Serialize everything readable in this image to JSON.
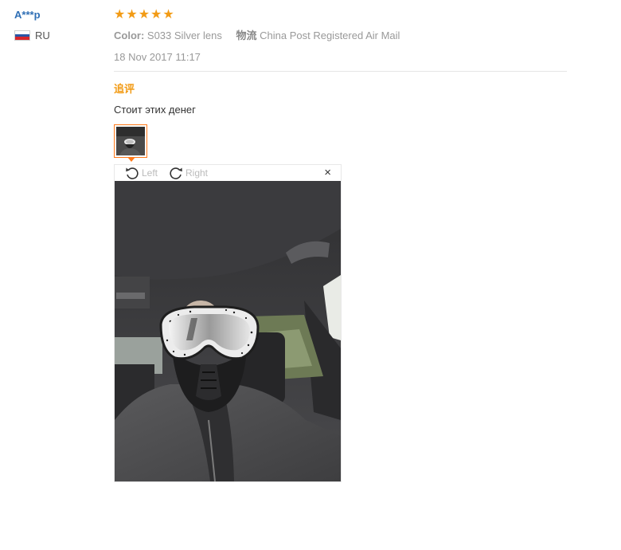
{
  "reviewer": {
    "name": "A***p",
    "country_code": "RU",
    "flag_icon": "russia-flag-icon",
    "flag_colors": [
      "#ffffff",
      "#2955a5",
      "#d7262b"
    ]
  },
  "review": {
    "rating": 5,
    "stars": [
      "★",
      "★",
      "★",
      "★",
      "★"
    ],
    "color_label": "Color:",
    "color_value": "S033 Silver lens",
    "shipping_label": "物流",
    "shipping_value": "China Post Registered Air Mail",
    "date": "18 Nov 2017 11:17",
    "followup_title": "追评",
    "followup_text": "Стоит этих денег"
  },
  "viewer": {
    "rotate_left_label": "Left",
    "rotate_right_label": "Right",
    "close_symbol": "×",
    "rotate_left_icon": "rotate-left-icon",
    "rotate_right_icon": "rotate-right-icon",
    "close_icon": "close-icon"
  },
  "colors": {
    "accent": "#f29b15",
    "thumb_border": "#ff7a1a",
    "link": "#2f6fb5",
    "muted": "#999999"
  }
}
